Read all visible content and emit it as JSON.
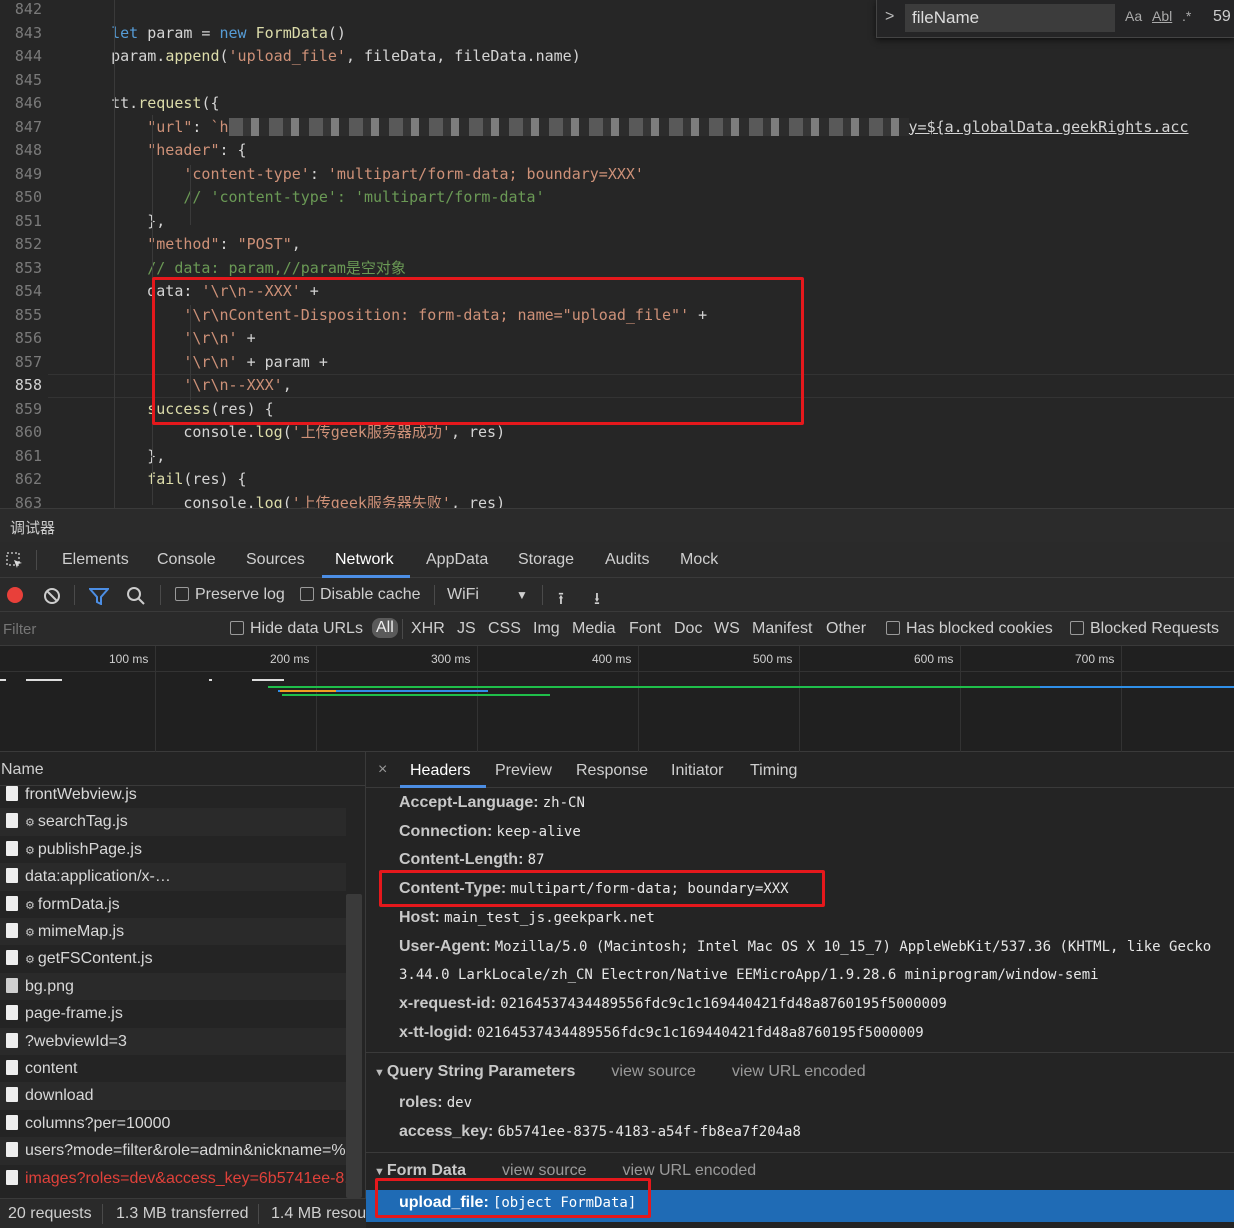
{
  "editor": {
    "lines": [
      {
        "n": "842",
        "html": ""
      },
      {
        "n": "843",
        "html": "    <span class=\"kw\">let</span> param = <span class=\"kw\">new</span> <span class=\"fn\">FormData</span>()"
      },
      {
        "n": "844",
        "html": "    param.<span class=\"fn\">append</span>(<span class=\"str\">'upload_file'</span>, fileData, fileData.name)"
      },
      {
        "n": "845",
        "html": ""
      },
      {
        "n": "846",
        "html": "    tt.<span class=\"fn\">request</span>({"
      },
      {
        "n": "847",
        "html": "        <span class=\"prop\">\"url\"</span>: <span class=\"str\">`h</span><span class=\"blur\"></span><span class=\"link\">y=${a.globalData.geekRights.acc</span>"
      },
      {
        "n": "848",
        "html": "        <span class=\"prop\">\"header\"</span>: {"
      },
      {
        "n": "849",
        "html": "            <span class=\"str\">'content-type'</span>: <span class=\"str\">'multipart/form-data; boundary=XXX'</span>"
      },
      {
        "n": "850",
        "html": "            <span class=\"cm\">// 'content-type': 'multipart/form-data'</span>"
      },
      {
        "n": "851",
        "html": "        },"
      },
      {
        "n": "852",
        "html": "        <span class=\"prop\">\"method\"</span>: <span class=\"str\">\"POST\"</span>,"
      },
      {
        "n": "853",
        "html": "        <span class=\"cm\">// data: param,//param是空对象</span>"
      },
      {
        "n": "854",
        "html": "        data: <span class=\"str\">'\\r\\n--XXX'</span> +"
      },
      {
        "n": "855",
        "html": "            <span class=\"str\">'\\r\\nContent-Disposition: form-data; name=\"upload_file\"'</span> +"
      },
      {
        "n": "856",
        "html": "            <span class=\"str\">'\\r\\n'</span> +"
      },
      {
        "n": "857",
        "html": "            <span class=\"str\">'\\r\\n'</span> + param +"
      },
      {
        "n": "858",
        "html": "            <span class=\"str\">'\\r\\n--XXX'</span>,"
      },
      {
        "n": "859",
        "html": "        <span class=\"fn\">success</span>(res) {"
      },
      {
        "n": "860",
        "html": "            console.<span class=\"fn\">log</span>(<span class=\"str\">'上传geek服务器成功'</span>, res)"
      },
      {
        "n": "861",
        "html": "        },"
      },
      {
        "n": "862",
        "html": "        <span class=\"fn\">fail</span>(res) {"
      },
      {
        "n": "863",
        "html": "            console.<span class=\"fn\">log</span>(<span class=\"str\">'上传geek服务器失败'</span>, res)"
      }
    ],
    "find": {
      "value": "fileName",
      "opt_case": "Aa",
      "opt_word": "Abl",
      "opt_regex": ".*",
      "count": "59"
    }
  },
  "devtools": {
    "title": "调试器",
    "tabs": [
      "Elements",
      "Console",
      "Sources",
      "Network",
      "AppData",
      "Storage",
      "Audits",
      "Mock"
    ],
    "active_tab": "Network",
    "toolbar": {
      "preserve_log": "Preserve log",
      "disable_cache": "Disable cache",
      "throttle": "WiFi"
    },
    "filter": {
      "placeholder": "Filter",
      "hide_data_urls": "Hide data URLs",
      "types": [
        "All",
        "XHR",
        "JS",
        "CSS",
        "Img",
        "Media",
        "Font",
        "Doc",
        "WS",
        "Manifest",
        "Other"
      ],
      "has_blocked_cookies": "Has blocked cookies",
      "blocked_requests": "Blocked Requests"
    },
    "timeline_ticks": [
      "100 ms",
      "200 ms",
      "300 ms",
      "400 ms",
      "500 ms",
      "600 ms",
      "700 ms"
    ],
    "requests": {
      "header": "Name",
      "items": [
        {
          "name": "frontWebview.js",
          "gear": false
        },
        {
          "name": "searchTag.js",
          "gear": true
        },
        {
          "name": "publishPage.js",
          "gear": true
        },
        {
          "name": "data:application/x-…",
          "gear": false
        },
        {
          "name": "formData.js",
          "gear": true
        },
        {
          "name": "mimeMap.js",
          "gear": true
        },
        {
          "name": "getFSContent.js",
          "gear": true
        },
        {
          "name": "bg.png",
          "gear": false
        },
        {
          "name": "page-frame.js",
          "gear": false
        },
        {
          "name": "?webviewId=3",
          "gear": false
        },
        {
          "name": "content",
          "gear": false
        },
        {
          "name": "download",
          "gear": false
        },
        {
          "name": "columns?per=10000",
          "gear": false
        },
        {
          "name": "users?mode=filter&role=admin&nickname=%.",
          "gear": false
        },
        {
          "name": "images?roles=dev&access_key=6b5741ee-8.",
          "gear": false,
          "error": true
        }
      ],
      "status": {
        "count": "20 requests",
        "transferred": "1.3 MB transferred",
        "resources": "1.4 MB resou"
      }
    },
    "details": {
      "tabs": [
        "Headers",
        "Preview",
        "Response",
        "Initiator",
        "Timing"
      ],
      "close": "×",
      "headers": [
        {
          "k": "Accept-Language:",
          "v": "zh-CN"
        },
        {
          "k": "Connection:",
          "v": "keep-alive"
        },
        {
          "k": "Content-Length:",
          "v": "87"
        },
        {
          "k": "Content-Type:",
          "v": "multipart/form-data; boundary=XXX"
        },
        {
          "k": "Host:",
          "v": "main_test_js.geekpark.net"
        },
        {
          "k": "User-Agent:",
          "v": "Mozilla/5.0 (Macintosh; Intel Mac OS X 10_15_7) AppleWebKit/537.36 (KHTML, like Gecko"
        },
        {
          "k": "",
          "v": "3.44.0 LarkLocale/zh_CN Electron/Native EEMicroApp/1.9.28.6 miniprogram/window-semi"
        },
        {
          "k": "x-request-id:",
          "v": "02164537434489556fdc9c1c169440421fd48a8760195f5000009"
        },
        {
          "k": "x-tt-logid:",
          "v": "02164537434489556fdc9c1c169440421fd48a8760195f5000009"
        }
      ],
      "query": {
        "title": "Query String Parameters",
        "view_source": "view source",
        "view_encoded": "view URL encoded",
        "params": [
          {
            "k": "roles:",
            "v": "dev"
          },
          {
            "k": "access_key:",
            "v": "6b5741ee-8375-4183-a54f-fb8ea7f204a8"
          }
        ]
      },
      "form": {
        "title": "Form Data",
        "view_source": "view source",
        "view_encoded": "view URL encoded",
        "params": [
          {
            "k": "upload_file:",
            "v": "[object FormData]"
          }
        ]
      }
    }
  },
  "colors": {
    "accent": "#4c8ee4",
    "highlight": "#e5181c",
    "selected": "#1f6bb5",
    "error": "#e0413a"
  }
}
